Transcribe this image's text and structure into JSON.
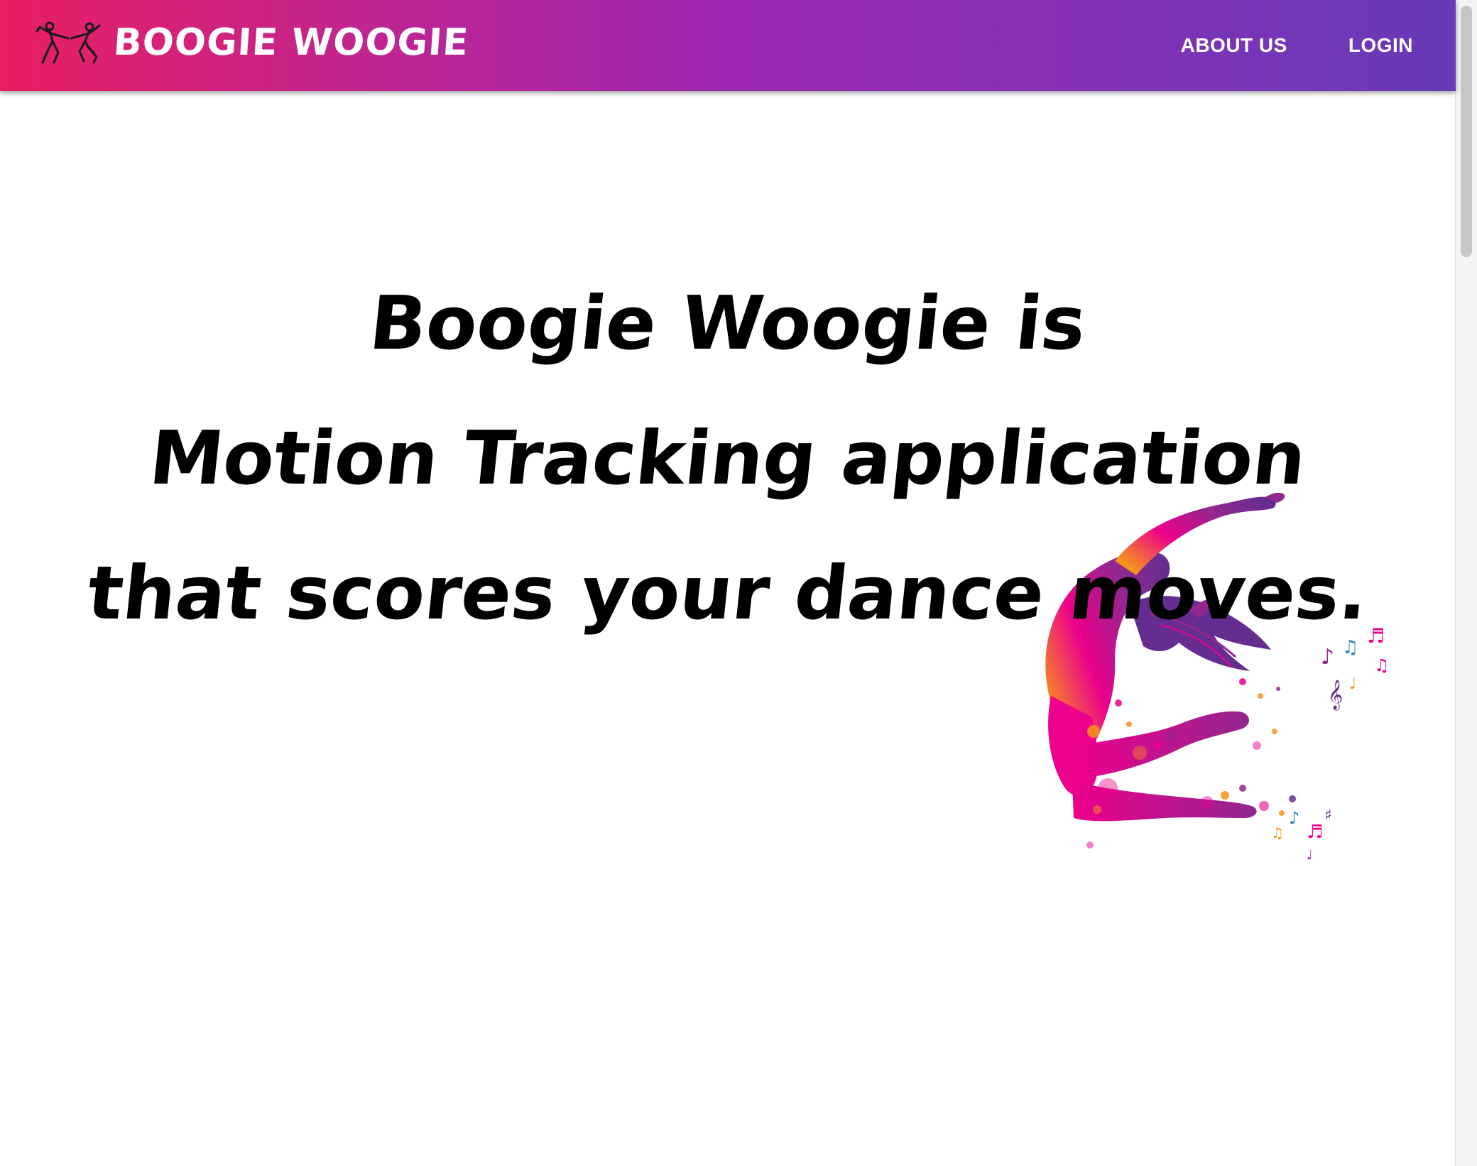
{
  "header": {
    "brand_name": "BOOGIE WOOGIE",
    "logo_icon": "dancing-couple-icon",
    "nav": [
      {
        "label": "ABOUT US"
      },
      {
        "label": "LOGIN"
      }
    ],
    "gradient_colors": [
      "#e91e63",
      "#9c27b0",
      "#673ab7"
    ]
  },
  "hero": {
    "lines": [
      "Boogie Woogie is",
      "Motion Tracking application",
      "that scores your dance moves."
    ]
  },
  "illustration": {
    "icon": "dancer-silhouette-illustration",
    "colors": [
      "#f7941d",
      "#ec008c",
      "#92278f",
      "#662d91"
    ]
  }
}
